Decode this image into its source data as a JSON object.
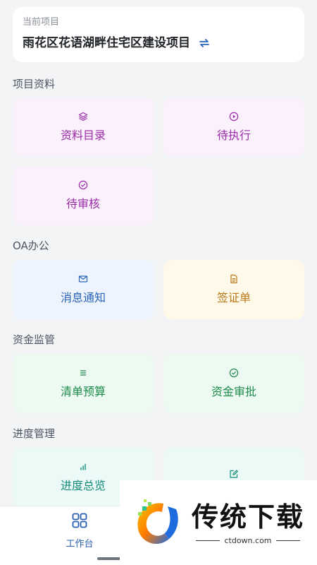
{
  "project": {
    "label": "当前项目",
    "name": "雨花区花语湖畔住宅区建设项目",
    "switch_icon": "swap-arrows-icon"
  },
  "sections": {
    "project_docs": {
      "title": "项目资料",
      "items": [
        {
          "label": "资料目录",
          "icon": "layers-icon"
        },
        {
          "label": "待执行",
          "icon": "play-circle-icon"
        },
        {
          "label": "待审核",
          "icon": "check-circle-icon"
        }
      ]
    },
    "oa": {
      "title": "OA办公",
      "items": [
        {
          "label": "消息通知",
          "icon": "mail-icon"
        },
        {
          "label": "签证单",
          "icon": "document-icon"
        }
      ]
    },
    "funds": {
      "title": "资金监管",
      "items": [
        {
          "label": "清单预算",
          "icon": "list-icon"
        },
        {
          "label": "资金审批",
          "icon": "check-circle-icon"
        }
      ]
    },
    "progress": {
      "title": "进度管理",
      "items": [
        {
          "label": "进度总览",
          "icon": "bar-chart-icon"
        },
        {
          "label": "",
          "icon": "edit-icon"
        }
      ]
    }
  },
  "bottom_nav": {
    "workbench_label": "工作台",
    "workbench_icon": "grid-icon"
  },
  "watermark": {
    "title": "传统下载",
    "url": "ctdown.com"
  },
  "colors": {
    "purple_text": "#9b2ca8",
    "blue_text": "#2a63b8",
    "yellow_text": "#b9781a",
    "green_text": "#1f8a4b",
    "teal_text": "#138a7a",
    "accent_blue": "#2a5fb0"
  }
}
